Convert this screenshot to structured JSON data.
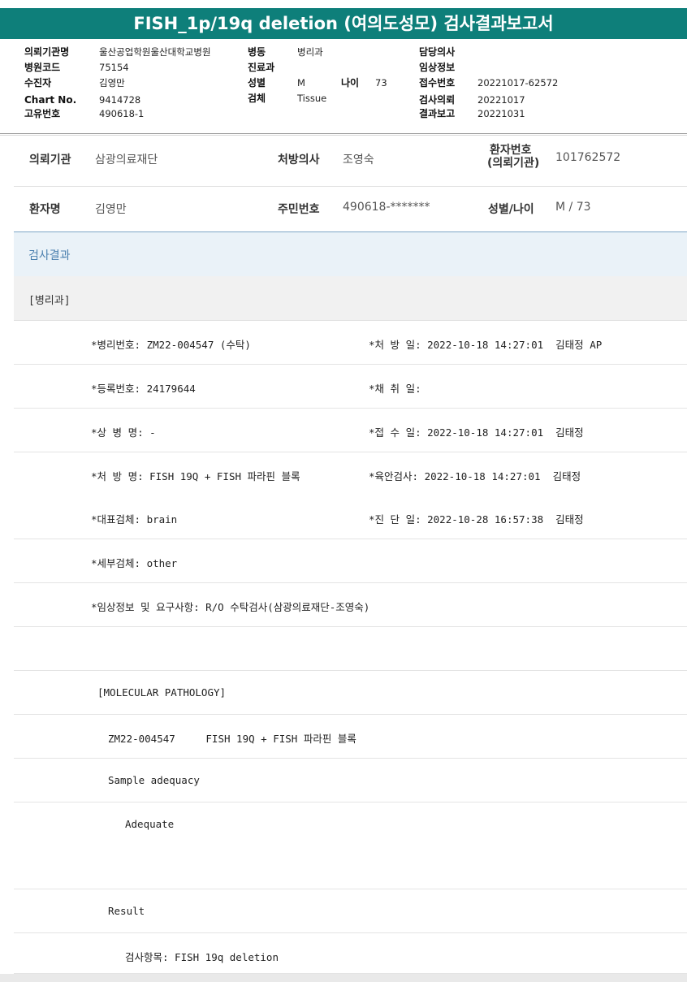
{
  "report": {
    "title": "FISH_1p/19q deletion (여의도성모) 검사결과보고서"
  },
  "header": {
    "left": [
      {
        "label": "의뢰기관명",
        "value": "울산공업학원울산대학교병원"
      },
      {
        "label": "병원코드",
        "value": "75154"
      },
      {
        "label": "수진자",
        "value": "김영만"
      },
      {
        "label": "Chart No.",
        "value": "9414728"
      },
      {
        "label": "고유번호",
        "value": "490618-1"
      }
    ],
    "middle": [
      {
        "label": "병동",
        "value": "병리과"
      },
      {
        "label": "진료과",
        "value": ""
      },
      {
        "label": "성별",
        "value": "M"
      },
      {
        "label": "검체",
        "value": "Tissue"
      }
    ],
    "age": {
      "label": "나이",
      "value": "73"
    },
    "right": [
      {
        "label": "담당의사",
        "value": ""
      },
      {
        "label": "임상정보",
        "value": ""
      },
      {
        "label": "접수번호",
        "value": "20221017-62572"
      },
      {
        "label": "검사의뢰",
        "value": "20221017"
      },
      {
        "label": "결과보고",
        "value": "20221031"
      }
    ]
  },
  "patient_info": {
    "row1": {
      "institution_label": "의뢰기관",
      "institution_value": "삼광의료재단",
      "doctor_label": "처방의사",
      "doctor_value": "조영숙",
      "patient_no_label_1": "환자번호",
      "patient_no_label_2": "(의뢰기관)",
      "patient_no_value": "101762572"
    },
    "row2": {
      "name_label": "환자명",
      "name_value": "김영만",
      "rrn_label": "주민번호",
      "rrn_value": "490618-*******",
      "sex_age_label": "성별/나이",
      "sex_age_value": "M / 73"
    }
  },
  "results": {
    "section_title": "검사결과",
    "department": "[병리과]",
    "rows": [
      {
        "left": "*병리번호: ZM22-004547 (수탁)",
        "right": "*처 방 일: 2022-10-18 14:27:01  김태정 AP"
      },
      {
        "left": "*등록번호: 24179644",
        "right": "*채 취 일:"
      },
      {
        "left": "*상 병 명: -",
        "right": "*접 수 일: 2022-10-18 14:27:01  김태정"
      },
      {
        "left": "*처 방 명: FISH 19Q + FISH 파라핀 블록",
        "right": "*육안검사: 2022-10-18 14:27:01  김태정"
      },
      {
        "left": "*대표검체: brain",
        "right": "*진 단 일: 2022-10-28 16:57:38  김태정"
      },
      {
        "left": "*세부검체: other",
        "right": ""
      },
      {
        "left": "*임상정보 및 요구사항: R/O 수탁검사(삼광의료재단-조영숙)",
        "right": ""
      }
    ],
    "body_lines": [
      {
        "text": "",
        "indent": 0
      },
      {
        "text": "[MOLECULAR PATHOLOGY]",
        "indent": 1
      },
      {
        "text": "ZM22-004547     FISH 19Q + FISH 파라핀 블록",
        "indent": 2
      },
      {
        "text": "Sample adequacy",
        "indent": 2
      },
      {
        "text": "Adequate",
        "indent": 3
      },
      {
        "text": "",
        "indent": 0
      },
      {
        "text": "Result",
        "indent": 2
      },
      {
        "text": "검사항목: FISH 19q deletion",
        "indent": 3
      }
    ]
  }
}
